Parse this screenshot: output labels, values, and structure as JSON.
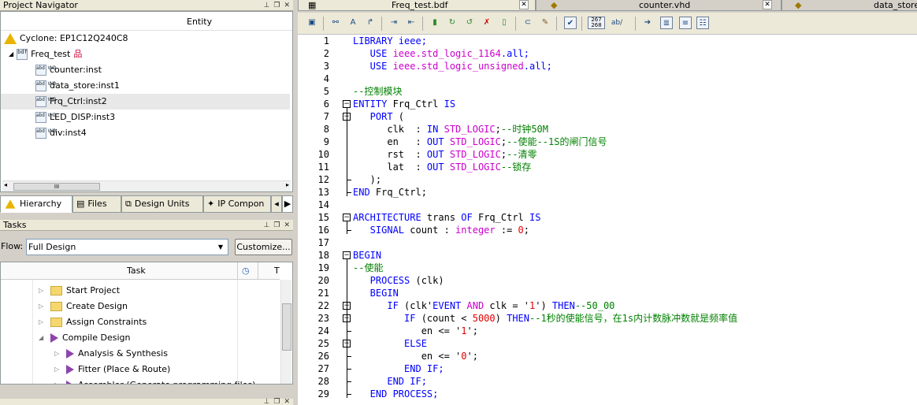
{
  "project_navigator": {
    "title": "Project Navigator",
    "column": "Entity",
    "device": "Cyclone: EP1C12Q240C8",
    "top_entity": "Freq_test",
    "instances": [
      {
        "label": "counter:inst"
      },
      {
        "label": "data_store:inst1"
      },
      {
        "label": "Frq_Ctrl:inst2",
        "selected": true
      },
      {
        "label": "LED_DISP:inst3"
      },
      {
        "label": "div:inst4"
      }
    ],
    "tabs": [
      "Hierarchy",
      "Files",
      "Design Units",
      "IP Compon"
    ]
  },
  "tasks": {
    "title": "Tasks",
    "flow_label": "Flow:",
    "flow_value": "Full Design",
    "customize": "Customize...",
    "col_task": "Task",
    "col_t": "T",
    "rows": [
      {
        "label": "Start Project",
        "icon": "folder-icon"
      },
      {
        "label": "Create Design",
        "icon": "folder-icon"
      },
      {
        "label": "Assign Constraints",
        "icon": "folder-icon"
      },
      {
        "label": "Compile Design",
        "icon": "play-icon",
        "expanded": true
      },
      {
        "label": "Analysis & Synthesis",
        "icon": "play-icon",
        "child": true
      },
      {
        "label": "Fitter (Place & Route)",
        "icon": "play-icon",
        "child": true
      },
      {
        "label": "Assembler (Generate programming files)",
        "icon": "play-icon",
        "child": true
      }
    ]
  },
  "document_tabs": [
    {
      "label": "Freq_test.bdf",
      "active": true
    },
    {
      "label": "counter.vhd"
    },
    {
      "label": "data_store"
    }
  ],
  "toolbar": {
    "line_col_label": "267 268",
    "abv_label": "ab/"
  },
  "code_lines": [
    [
      {
        "t": "LIBRARY ieee;",
        "c": "kw"
      }
    ],
    [
      {
        "t": "   USE ",
        "c": "kw"
      },
      {
        "t": "ieee.std_logic_1164",
        "c": "ty"
      },
      {
        "t": ".all;",
        "c": "kw"
      }
    ],
    [
      {
        "t": "   USE ",
        "c": "kw"
      },
      {
        "t": "ieee.std_logic_unsigned",
        "c": "ty"
      },
      {
        "t": ".all;",
        "c": "kw"
      }
    ],
    [
      {
        "t": "",
        "c": ""
      }
    ],
    [
      {
        "t": "--控制模块",
        "c": "cm"
      }
    ],
    [
      {
        "t": "ENTITY ",
        "c": "kw"
      },
      {
        "t": "Frq_Ctrl ",
        "c": ""
      },
      {
        "t": "IS",
        "c": "kw"
      }
    ],
    [
      {
        "t": "   PORT ",
        "c": "kw"
      },
      {
        "t": "(",
        "c": ""
      }
    ],
    [
      {
        "t": "      clk  : ",
        "c": ""
      },
      {
        "t": "IN ",
        "c": "kw"
      },
      {
        "t": "STD_LOGIC",
        "c": "ty"
      },
      {
        "t": ";",
        "c": ""
      },
      {
        "t": "--时钟50M",
        "c": "cm"
      }
    ],
    [
      {
        "t": "      en   : ",
        "c": ""
      },
      {
        "t": "OUT ",
        "c": "kw"
      },
      {
        "t": "STD_LOGIC",
        "c": "ty"
      },
      {
        "t": ";",
        "c": ""
      },
      {
        "t": "--使能--1S的闸门信号",
        "c": "cm"
      }
    ],
    [
      {
        "t": "      rst  : ",
        "c": ""
      },
      {
        "t": "OUT ",
        "c": "kw"
      },
      {
        "t": "STD_LOGIC",
        "c": "ty"
      },
      {
        "t": ";",
        "c": ""
      },
      {
        "t": "--清零",
        "c": "cm"
      }
    ],
    [
      {
        "t": "      lat  : ",
        "c": ""
      },
      {
        "t": "OUT ",
        "c": "kw"
      },
      {
        "t": "STD_LOGIC",
        "c": "ty"
      },
      {
        "t": "--锁存",
        "c": "cm"
      }
    ],
    [
      {
        "t": "   );",
        "c": ""
      }
    ],
    [
      {
        "t": "END ",
        "c": "kw"
      },
      {
        "t": "Frq_Ctrl;",
        "c": ""
      }
    ],
    [
      {
        "t": "",
        "c": ""
      }
    ],
    [
      {
        "t": "ARCHITECTURE ",
        "c": "kw"
      },
      {
        "t": "trans ",
        "c": ""
      },
      {
        "t": "OF ",
        "c": "kw"
      },
      {
        "t": "Frq_Ctrl ",
        "c": ""
      },
      {
        "t": "IS",
        "c": "kw"
      }
    ],
    [
      {
        "t": "   SIGNAL ",
        "c": "kw"
      },
      {
        "t": "count : ",
        "c": ""
      },
      {
        "t": "integer",
        "c": "ty"
      },
      {
        "t": " := ",
        "c": ""
      },
      {
        "t": "0",
        "c": "nm"
      },
      {
        "t": ";",
        "c": ""
      }
    ],
    [
      {
        "t": "",
        "c": ""
      }
    ],
    [
      {
        "t": "BEGIN",
        "c": "kw"
      }
    ],
    [
      {
        "t": "--使能",
        "c": "cm"
      }
    ],
    [
      {
        "t": "   PROCESS ",
        "c": "kw"
      },
      {
        "t": "(clk)",
        "c": ""
      }
    ],
    [
      {
        "t": "   BEGIN",
        "c": "kw"
      }
    ],
    [
      {
        "t": "      IF ",
        "c": "kw"
      },
      {
        "t": "(clk'",
        "c": ""
      },
      {
        "t": "EVENT ",
        "c": "kw"
      },
      {
        "t": "AND ",
        "c": "ty"
      },
      {
        "t": "clk = '",
        "c": ""
      },
      {
        "t": "1",
        "c": "st"
      },
      {
        "t": "') ",
        "c": ""
      },
      {
        "t": "THEN",
        "c": "kw"
      },
      {
        "t": "--50_00",
        "c": "cm"
      }
    ],
    [
      {
        "t": "         IF ",
        "c": "kw"
      },
      {
        "t": "(count < ",
        "c": ""
      },
      {
        "t": "5000",
        "c": "nm"
      },
      {
        "t": ") ",
        "c": ""
      },
      {
        "t": "THEN",
        "c": "kw"
      },
      {
        "t": "--1秒的使能信号，在1s内计数脉冲数就是频率值",
        "c": "cm"
      }
    ],
    [
      {
        "t": "            en <= '",
        "c": ""
      },
      {
        "t": "1",
        "c": "st"
      },
      {
        "t": "';",
        "c": ""
      }
    ],
    [
      {
        "t": "         ELSE",
        "c": "kw"
      }
    ],
    [
      {
        "t": "            en <= '",
        "c": ""
      },
      {
        "t": "0",
        "c": "st"
      },
      {
        "t": "';",
        "c": ""
      }
    ],
    [
      {
        "t": "         END IF;",
        "c": "kw"
      }
    ],
    [
      {
        "t": "      END IF;",
        "c": "kw"
      }
    ],
    [
      {
        "t": "   END PROCESS;",
        "c": "kw"
      }
    ]
  ]
}
